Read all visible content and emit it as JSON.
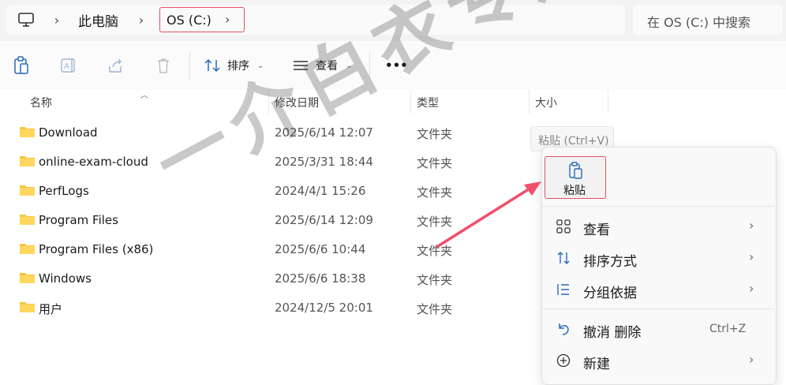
{
  "address": {
    "breadcrumb": [
      "此电脑",
      "OS (C:)"
    ],
    "search_placeholder": "在 OS (C:) 中搜索"
  },
  "toolbar": {
    "icons": [
      "clipboard-icon",
      "rename-icon",
      "share-icon",
      "trash-icon"
    ],
    "sort_label": "排序",
    "view_label": "查看",
    "more_label": "•••"
  },
  "columns": [
    "名称",
    "修改日期",
    "类型",
    "大小"
  ],
  "files": [
    {
      "name": "Download",
      "date": "2025/6/14 12:07",
      "type": "文件夹"
    },
    {
      "name": "online-exam-cloud",
      "date": "2025/3/31 18:44",
      "type": "文件夹"
    },
    {
      "name": "PerfLogs",
      "date": "2024/4/1 15:26",
      "type": "文件夹"
    },
    {
      "name": "Program Files",
      "date": "2025/6/14 12:09",
      "type": "文件夹"
    },
    {
      "name": "Program Files (x86)",
      "date": "2025/6/6 10:44",
      "type": "文件夹"
    },
    {
      "name": "Windows",
      "date": "2025/6/6 18:38",
      "type": "文件夹"
    },
    {
      "name": "用户",
      "date": "2024/12/5 20:01",
      "type": "文件夹"
    }
  ],
  "tooltip": "粘贴 (Ctrl+V)",
  "context_menu": {
    "paste_label": "粘贴",
    "items": [
      {
        "label": "查看",
        "icon": "grid-icon",
        "arrow": "›"
      },
      {
        "label": "排序方式",
        "icon": "sort-icon",
        "arrow": "›"
      },
      {
        "label": "分组依据",
        "icon": "group-icon",
        "arrow": "›"
      },
      {
        "label": "撤消 删除",
        "icon": "undo-icon",
        "shortcut": "Ctrl+Z"
      },
      {
        "label": "新建",
        "icon": "plus-circle-icon",
        "arrow": "›"
      }
    ]
  },
  "watermark": "一介白衣专用",
  "colors": {
    "highlight_border": "#e05060",
    "arrow": "#f0506a",
    "folder": "#f5c542"
  }
}
